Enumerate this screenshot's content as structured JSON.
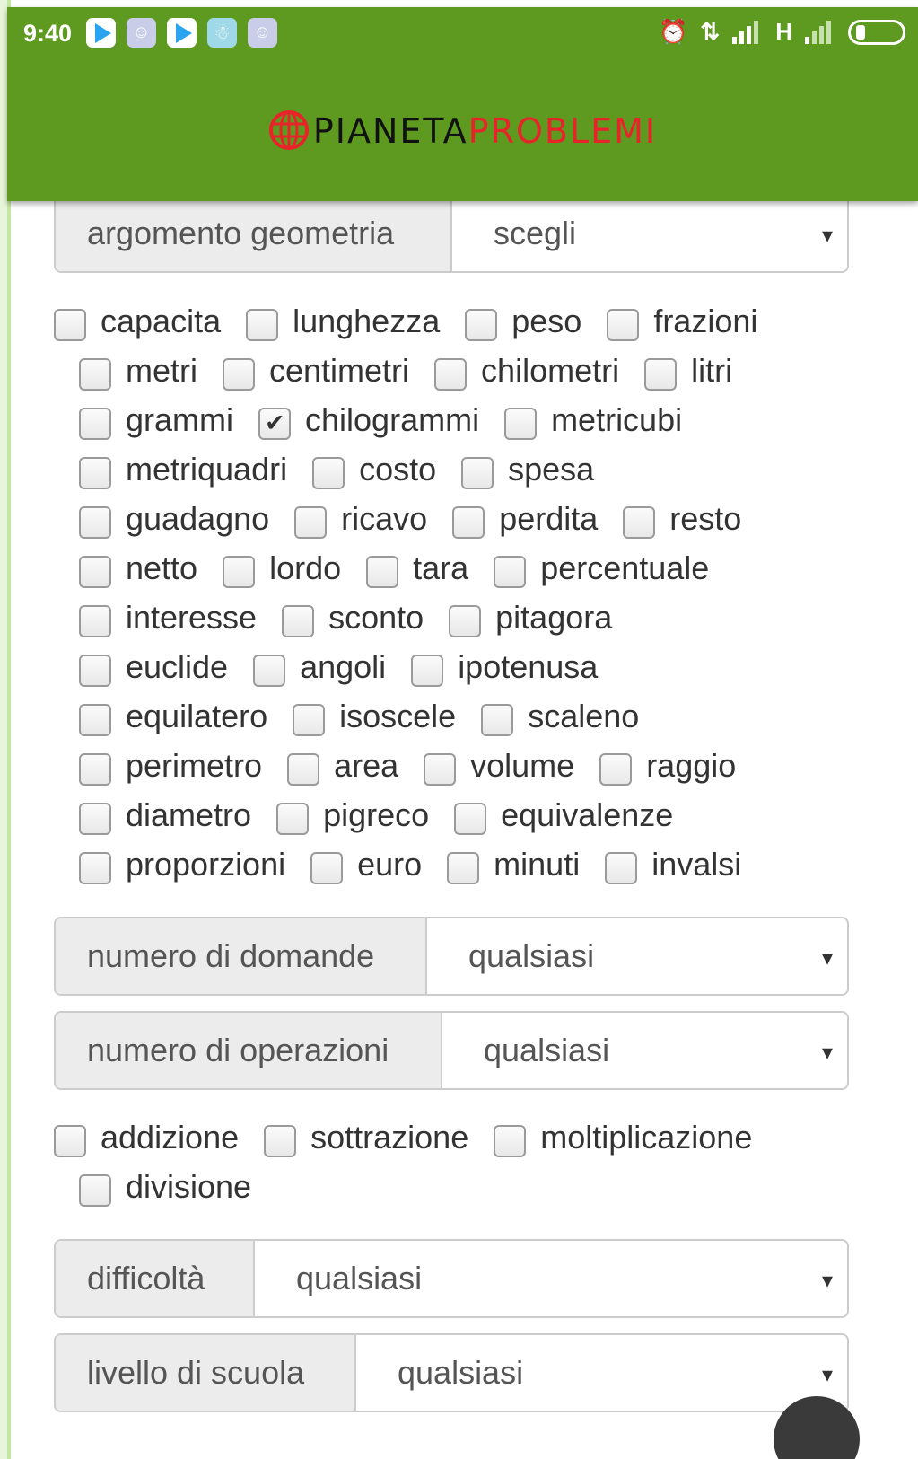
{
  "status_bar": {
    "time": "9:40",
    "notification_icons": [
      "play-store-icon",
      "game-icon",
      "play-store-icon",
      "snowman-icon",
      "game-icon"
    ],
    "right_text": "H",
    "system_icons": [
      "alarm-icon",
      "data-transfer-icon",
      "signal-icon",
      "signal-icon",
      "battery-icon"
    ]
  },
  "brand": {
    "part1": "PIANETA",
    "part2": "PROBLEMI",
    "color_primary": "#5d9a1f",
    "color_accent": "#e8232a"
  },
  "selects": {
    "argomento": {
      "label": "argomento geometria",
      "value": "scegli"
    },
    "domande": {
      "label": "numero di domande",
      "value": "qualsiasi"
    },
    "operazioni": {
      "label": "numero di operazioni",
      "value": "qualsiasi"
    },
    "difficolta": {
      "label": "difficoltà",
      "value": "qualsiasi"
    },
    "livello": {
      "label": "livello di scuola",
      "value": "qualsiasi"
    }
  },
  "arrow_glyph": "▾",
  "topics": [
    [
      {
        "label": "capacita",
        "checked": false
      },
      {
        "label": "lunghezza",
        "checked": false
      },
      {
        "label": "peso",
        "checked": false
      },
      {
        "label": "frazioni",
        "checked": false
      }
    ],
    [
      {
        "label": "metri",
        "checked": false
      },
      {
        "label": "centimetri",
        "checked": false
      },
      {
        "label": "chilometri",
        "checked": false
      },
      {
        "label": "litri",
        "checked": false
      }
    ],
    [
      {
        "label": "grammi",
        "checked": false
      },
      {
        "label": "chilogrammi",
        "checked": true
      },
      {
        "label": "metricubi",
        "checked": false
      }
    ],
    [
      {
        "label": "metriquadri",
        "checked": false
      },
      {
        "label": "costo",
        "checked": false
      },
      {
        "label": "spesa",
        "checked": false
      }
    ],
    [
      {
        "label": "guadagno",
        "checked": false
      },
      {
        "label": "ricavo",
        "checked": false
      },
      {
        "label": "perdita",
        "checked": false
      },
      {
        "label": "resto",
        "checked": false
      }
    ],
    [
      {
        "label": "netto",
        "checked": false
      },
      {
        "label": "lordo",
        "checked": false
      },
      {
        "label": "tara",
        "checked": false
      },
      {
        "label": "percentuale",
        "checked": false
      }
    ],
    [
      {
        "label": "interesse",
        "checked": false
      },
      {
        "label": "sconto",
        "checked": false
      },
      {
        "label": "pitagora",
        "checked": false
      }
    ],
    [
      {
        "label": "euclide",
        "checked": false
      },
      {
        "label": "angoli",
        "checked": false
      },
      {
        "label": "ipotenusa",
        "checked": false
      }
    ],
    [
      {
        "label": "equilatero",
        "checked": false
      },
      {
        "label": "isoscele",
        "checked": false
      },
      {
        "label": "scaleno",
        "checked": false
      }
    ],
    [
      {
        "label": "perimetro",
        "checked": false
      },
      {
        "label": "area",
        "checked": false
      },
      {
        "label": "volume",
        "checked": false
      },
      {
        "label": "raggio",
        "checked": false
      }
    ],
    [
      {
        "label": "diametro",
        "checked": false
      },
      {
        "label": "pigreco",
        "checked": false
      },
      {
        "label": "equivalenze",
        "checked": false
      }
    ],
    [
      {
        "label": "proporzioni",
        "checked": false
      },
      {
        "label": "euro",
        "checked": false
      },
      {
        "label": "minuti",
        "checked": false
      },
      {
        "label": "invalsi",
        "checked": false
      }
    ]
  ],
  "operations": [
    [
      {
        "label": "addizione",
        "checked": false
      },
      {
        "label": "sottrazione",
        "checked": false
      },
      {
        "label": "moltiplicazione",
        "checked": false
      }
    ],
    [
      {
        "label": "divisione",
        "checked": false
      }
    ]
  ]
}
